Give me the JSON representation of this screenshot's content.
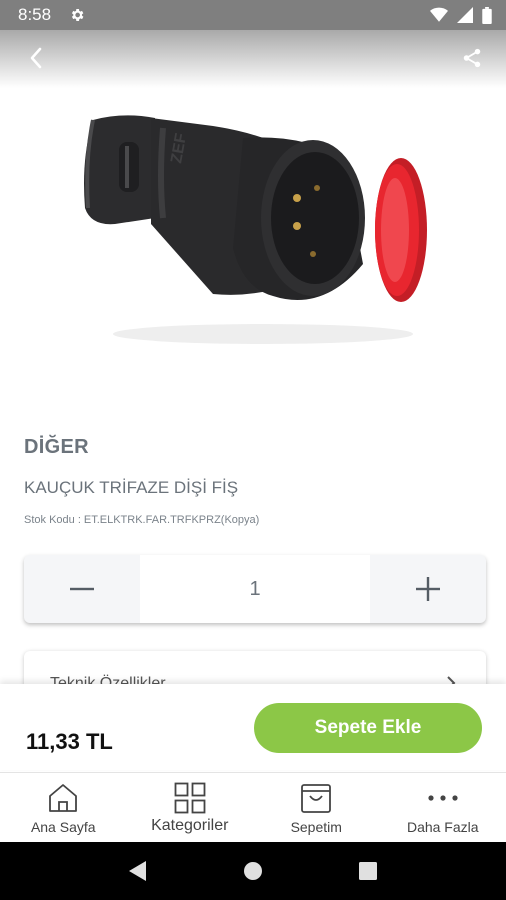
{
  "status_bar": {
    "time": "8:58",
    "icons": [
      "settings-gear-icon",
      "wifi-icon",
      "signal-icon",
      "battery-icon"
    ]
  },
  "header": {
    "back_icon": "chevron-left-icon",
    "share_icon": "share-icon"
  },
  "product": {
    "brand": "DİĞER",
    "name": "KAUÇUK TRİFAZE DİŞİ FİŞ",
    "stock_label": "Stok Kodu :",
    "stock_code": "ET.ELKTRK.FAR.TRFKPRZ(Kopya)",
    "image_colors": {
      "body": "#2a2a2c",
      "cap": "#e8262f"
    },
    "image_text": "ZEF"
  },
  "quantity": {
    "value": "1",
    "decrement_icon": "minus-icon",
    "increment_icon": "plus-icon"
  },
  "info_card": {
    "label": "Teknik Özellikler",
    "icon": "chevron-right-icon"
  },
  "buy_bar": {
    "price": "11,33 TL",
    "add_to_cart_label": "Sepete Ekle",
    "accent_color": "#8cc747"
  },
  "bottom_nav": {
    "items": [
      {
        "label": "Ana Sayfa",
        "icon": "home-icon"
      },
      {
        "label": "Kategoriler",
        "icon": "grid-icon"
      },
      {
        "label": "Sepetim",
        "icon": "cart-bag-icon"
      },
      {
        "label": "Daha Fazla",
        "icon": "more-dots-icon"
      }
    ]
  },
  "android_nav": {
    "buttons": [
      "back-triangle-icon",
      "home-circle-icon",
      "recents-square-icon"
    ]
  }
}
